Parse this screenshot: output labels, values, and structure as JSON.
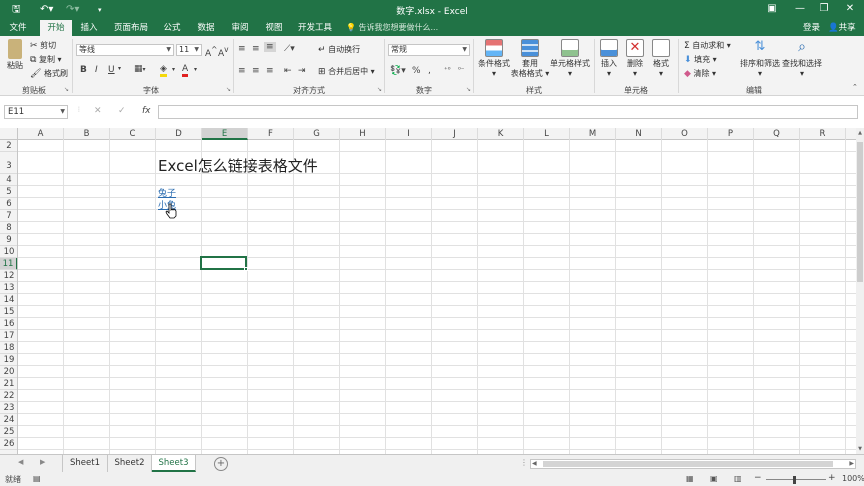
{
  "window": {
    "title": "数字.xlsx - Excel",
    "qa_icons": [
      "save-icon",
      "undo-icon",
      "redo-icon",
      "customize-icon"
    ],
    "controls": [
      "ribbon-display-icon",
      "minimize-icon",
      "restore-icon",
      "close-icon"
    ]
  },
  "tabs": {
    "items": [
      "文件",
      "开始",
      "插入",
      "页面布局",
      "公式",
      "数据",
      "审阅",
      "视图",
      "开发工具"
    ],
    "active": "开始",
    "tell_me": "告诉我您想要做什么...",
    "login": "登录",
    "share": "共享"
  },
  "ribbon": {
    "clipboard": {
      "paste": "粘贴",
      "cut": "剪切",
      "copy": "复制",
      "format_painter": "格式刷",
      "label": "剪贴板"
    },
    "font": {
      "name": "等线",
      "size": "11",
      "bold": "B",
      "italic": "I",
      "underline": "U",
      "label": "字体"
    },
    "alignment": {
      "wrap": "自动换行",
      "merge": "合并后居中",
      "label": "对齐方式"
    },
    "number": {
      "format": "常规",
      "percent": "%",
      "comma": ",",
      "label": "数字"
    },
    "styles": {
      "conditional": "条件格式",
      "table_line1": "套用",
      "table_line2": "表格格式",
      "cell_styles": "单元格样式",
      "label": "样式"
    },
    "cells": {
      "insert": "插入",
      "delete": "删除",
      "format": "格式",
      "label": "单元格"
    },
    "editing": {
      "autosum": "自动求和",
      "fill": "填充",
      "clear": "清除",
      "sort": "排序和筛选",
      "find": "查找和选择",
      "label": "编辑"
    }
  },
  "formula_bar": {
    "name_box": "E11",
    "fx": "fx",
    "formula": ""
  },
  "grid": {
    "columns": [
      "A",
      "B",
      "C",
      "D",
      "E",
      "F",
      "G",
      "H",
      "I",
      "J",
      "K",
      "L",
      "M",
      "N",
      "O",
      "P",
      "Q",
      "R"
    ],
    "rows": [
      "2",
      "3",
      "4",
      "5",
      "6",
      "7",
      "8",
      "9",
      "10",
      "11",
      "12",
      "13",
      "14",
      "15",
      "16",
      "17",
      "18",
      "19",
      "20",
      "21",
      "22",
      "23",
      "24",
      "25",
      "26"
    ],
    "selected_column": "E",
    "selected_row": "11",
    "title": "Excel怎么链接表格文件",
    "links": [
      "兔子",
      "小兔"
    ]
  },
  "sheets": {
    "tabs": [
      "Sheet1",
      "Sheet2",
      "Sheet3"
    ],
    "active": "Sheet3"
  },
  "status": {
    "ready": "就绪",
    "zoom": "100%"
  },
  "colors": {
    "accent": "#217346",
    "link": "#2b6cb0"
  }
}
